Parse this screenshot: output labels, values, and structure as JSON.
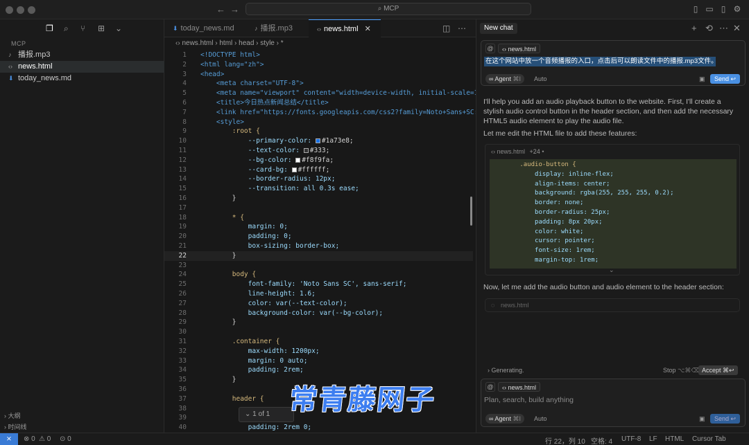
{
  "window": {
    "title": "MCP"
  },
  "titlebar": {
    "back_icon": "←",
    "forward_icon": "→",
    "search_icon": "⌕"
  },
  "sidebar": {
    "section_title": "MCP",
    "files": [
      {
        "icon": "audio",
        "name": "播报.mp3"
      },
      {
        "icon": "html",
        "name": "news.html",
        "active": true
      },
      {
        "icon": "markdown",
        "name": "today_news.md"
      }
    ],
    "bottom": [
      "大纲",
      "时间线"
    ]
  },
  "editor": {
    "tabs": [
      {
        "name": "today_news.md"
      },
      {
        "name": "播报.mp3"
      },
      {
        "name": "news.html",
        "active": true,
        "close": "✕"
      }
    ],
    "breadcrumb": [
      "news.html",
      "html",
      "head",
      "style",
      "*"
    ],
    "current_line": 22,
    "find_widget": "1 of 1"
  },
  "code": [
    {
      "n": 1,
      "t": "<!DOCTYPE html>"
    },
    {
      "n": 2,
      "t": "<html lang=\"zh\">"
    },
    {
      "n": 3,
      "t": "<head>"
    },
    {
      "n": 4,
      "t": "    <meta charset=\"UTF-8\">"
    },
    {
      "n": 5,
      "t": "    <meta name=\"viewport\" content=\"width=device-width, initial-scale=1."
    },
    {
      "n": 6,
      "t": "    <title>今日热点新闻总结</title>"
    },
    {
      "n": 7,
      "t": "    <link href=\"https://fonts.googleapis.com/css2?family=Noto+Sans+SC:w"
    },
    {
      "n": 8,
      "t": "    <style>"
    },
    {
      "n": 9,
      "t": "        :root {"
    },
    {
      "n": 10,
      "t": "            --primary-color: #1a73e8;",
      "swatch": "#1a73e8"
    },
    {
      "n": 11,
      "t": "            --text-color: #333;",
      "swatch": "#333333"
    },
    {
      "n": 12,
      "t": "            --bg-color: #f8f9fa;",
      "swatch": "#f8f9fa"
    },
    {
      "n": 13,
      "t": "            --card-bg: #ffffff;",
      "swatch": "#ffffff"
    },
    {
      "n": 14,
      "t": "            --border-radius: 12px;"
    },
    {
      "n": 15,
      "t": "            --transition: all 0.3s ease;"
    },
    {
      "n": 16,
      "t": "        }"
    },
    {
      "n": 17,
      "t": ""
    },
    {
      "n": 18,
      "t": "        * {"
    },
    {
      "n": 19,
      "t": "            margin: 0;"
    },
    {
      "n": 20,
      "t": "            padding: 0;"
    },
    {
      "n": 21,
      "t": "            box-sizing: border-box;"
    },
    {
      "n": 22,
      "t": "        }"
    },
    {
      "n": 23,
      "t": ""
    },
    {
      "n": 24,
      "t": "        body {"
    },
    {
      "n": 25,
      "t": "            font-family: 'Noto Sans SC', sans-serif;"
    },
    {
      "n": 26,
      "t": "            line-height: 1.6;"
    },
    {
      "n": 27,
      "t": "            color: var(--text-color);"
    },
    {
      "n": 28,
      "t": "            background-color: var(--bg-color);"
    },
    {
      "n": 29,
      "t": "        }"
    },
    {
      "n": 30,
      "t": ""
    },
    {
      "n": 31,
      "t": "        .container {"
    },
    {
      "n": 32,
      "t": "            max-width: 1200px;"
    },
    {
      "n": 33,
      "t": "            margin: 0 auto;"
    },
    {
      "n": 34,
      "t": "            padding: 2rem;"
    },
    {
      "n": 35,
      "t": "        }"
    },
    {
      "n": 36,
      "t": ""
    },
    {
      "n": 37,
      "t": "        header {"
    },
    {
      "n": 38,
      "t": ""
    },
    {
      "n": 39,
      "t": ""
    },
    {
      "n": 40,
      "t": "            padding: 2rem 0;"
    }
  ],
  "chat": {
    "tab_label": "New chat",
    "context_file": "news.html",
    "user_message": "在这个网站中放一个音频播报的入口，点击后可以朗读文件中的播报.mp3文件。",
    "agent_label": "Agent",
    "agent_shortcut": "⌘I",
    "auto_label": "Auto",
    "send_label": "Send",
    "send_shortcut": "↩",
    "reply_1": "I'll help you add an audio playback button to the website. First, I'll create a stylish audio control button in the header section, and then add the necessary HTML5 audio element to play the audio file.",
    "reply_2": "Let me edit the HTML file to add these features:",
    "code_block": {
      "file": "news.html",
      "diff": "+24",
      "lines": [
        "        .audio-button {",
        "            display: inline-flex;",
        "            align-items: center;",
        "            background: rgba(255, 255, 255, 0.2);",
        "            border: none;",
        "            border-radius: 25px;",
        "            padding: 8px 20px;",
        "            color: white;",
        "            cursor: pointer;",
        "            font-size: 1rem;",
        "            margin-top: 1rem;"
      ]
    },
    "reply_3": "Now, let me add the audio button and audio element to the header section:",
    "pending_file": "news.html",
    "generating": "Generating.",
    "stop_label": "Stop",
    "stop_shortcut": "⌥⌘⌫",
    "accept_label": "Accept",
    "accept_shortcut": "⌘↩",
    "input_placeholder": "Plan, search, build anything"
  },
  "status": {
    "errors": "0",
    "warnings": "0",
    "ports": "0",
    "position": "行 22，列 10",
    "spaces": "空格: 4",
    "encoding": "UTF-8",
    "eol": "LF",
    "language": "HTML",
    "cursor_tab": "Cursor Tab"
  },
  "watermark": "常青藤网子",
  "colors": {
    "accent": "#4a90e2",
    "selection": "#264f78",
    "watermark": "#3d7ef0"
  }
}
